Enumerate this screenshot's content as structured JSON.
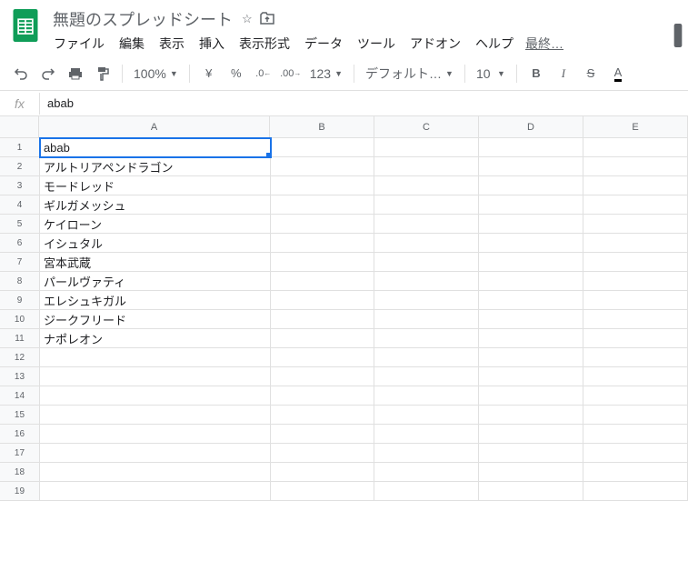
{
  "doc": {
    "title": "無題のスプレッドシート"
  },
  "menu": {
    "file": "ファイル",
    "edit": "編集",
    "view": "表示",
    "insert": "挿入",
    "format": "表示形式",
    "data": "データ",
    "tools": "ツール",
    "addons": "アドオン",
    "help": "ヘルプ",
    "last_edit": "最終…"
  },
  "toolbar": {
    "zoom": "100%",
    "currency": "¥",
    "percent": "%",
    "dec_dec": ".0",
    "dec_inc": ".00",
    "num_fmt": "123",
    "font": "デフォルト…",
    "font_size": "10",
    "bold": "B",
    "italic": "I",
    "strike": "S",
    "text_color": "A"
  },
  "formula": {
    "fx": "fx",
    "value": "abab"
  },
  "columns": {
    "A": "A",
    "B": "B",
    "C": "C",
    "D": "D",
    "E": "E"
  },
  "cells": {
    "A1": "abab",
    "A2": "アルトリアペンドラゴン",
    "A3": "モードレッド",
    "A4": "ギルガメッシュ",
    "A5": "ケイローン",
    "A6": "イシュタル",
    "A7": "宮本武蔵",
    "A8": "パールヴァティ",
    "A9": "エレシュキガル",
    "A10": "ジークフリード",
    "A11": "ナポレオン"
  },
  "row_labels": [
    "1",
    "2",
    "3",
    "4",
    "5",
    "6",
    "7",
    "8",
    "9",
    "10",
    "11",
    "12",
    "13",
    "14",
    "15",
    "16",
    "17",
    "18",
    "19"
  ]
}
